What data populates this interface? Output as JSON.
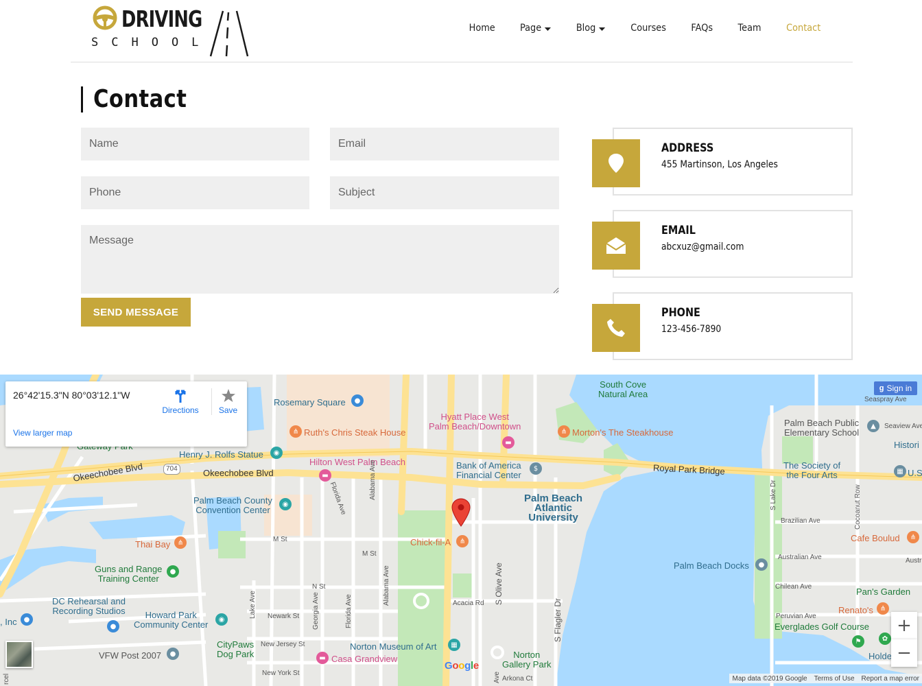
{
  "brand": {
    "top": "DRIVING",
    "bottom": "SCHOOL"
  },
  "nav": {
    "items": [
      {
        "label": "Home"
      },
      {
        "label": "Page"
      },
      {
        "label": "Blog"
      },
      {
        "label": "Courses"
      },
      {
        "label": "FAQs"
      },
      {
        "label": "Team"
      },
      {
        "label": "Contact"
      }
    ]
  },
  "contact": {
    "title": "Contact",
    "form": {
      "name_placeholder": "Name",
      "email_placeholder": "Email",
      "phone_placeholder": "Phone",
      "subject_placeholder": "Subject",
      "message_placeholder": "Message",
      "send_label": "SEND MESSAGE"
    },
    "info": [
      {
        "heading": "ADDRESS",
        "text": "455 Martinson, Los Angeles",
        "icon": "map-marker-icon"
      },
      {
        "heading": "EMAIL",
        "text": "abcxuz@gmail.com",
        "icon": "envelope-open-icon"
      },
      {
        "heading": "PHONE",
        "text": "123-456-7890",
        "icon": "phone-icon"
      }
    ]
  },
  "map": {
    "coordinates": "26°42'15.3\"N 80°03'12.1\"W",
    "directions_label": "Directions",
    "save_label": "Save",
    "larger_map_label": "View larger map",
    "sign_in_label": "Sign in",
    "zoom_in": "+",
    "zoom_out": "−",
    "logo": "Google",
    "attribution": [
      "Map data ©2019 Google",
      "Terms of Use",
      "Report a map error"
    ],
    "labels": {
      "rosemary": "Rosemary Square",
      "ruths": "Ruth's Chris Steak House",
      "hyatt": "Hyatt Place West\nPalm Beach/Downtown",
      "mortons": "Morton's The Steakhouse",
      "south_cove": "South Cove\nNatural Area",
      "seaspray": "Seaspray Ave",
      "pb_school": "Palm Beach Public\nElementary School",
      "seaview": "Seaview Ave",
      "histori": "Histori",
      "gateway": "Gateway Park",
      "rolfs": "Henry J. Rolfs Statue",
      "hilton": "Hilton West Palm Beach",
      "bofa": "Bank of America\nFinancial Center",
      "royal": "Royal Park Bridge",
      "society": "The Society of\nthe Four Arts",
      "us": "U.S",
      "okeechobee1": "Okeechobee Blvd",
      "okeechobee2": "Okeechobee Blvd",
      "route": "704",
      "convention": "Palm Beach County\nConvention Center",
      "university": "Palm Beach\nAtlantic\nUniversity",
      "flagler": "S Flagler Dr",
      "brazilian": "Brazilian Ave",
      "cafe": "Cafe Boulud",
      "thai": "Thai Bay",
      "m_st1": "M St",
      "m_st2": "M St",
      "chick": "Chick-fil-A",
      "australian": "Australian Ave",
      "austr": "Austr",
      "guns": "Guns and Range\nTraining Center",
      "docks": "Palm Beach Docks",
      "n_st": "N St",
      "chilean": "Chilean Ave",
      "pans": "Pan's Garden",
      "dc": "DC Rehearsal and\nRecording Studios",
      "acacia": "Acacia Rd",
      "renatos": "Renato's",
      "inc": ", Inc",
      "howard": "Howard Park\nCommunity Center",
      "newark": "Newark St",
      "peruvian": "Peruvian Ave",
      "everglades": "Everglades Golf Course",
      "citypaws": "CityPaws\nDog Park",
      "new_jersey": "New Jersey St",
      "norton_museum": "Norton Museum of Art",
      "norton_park": "Norton\nGallery Park",
      "vfw": "VFW Post 2007",
      "casa": "Casa Grandview",
      "new_york": "New York St",
      "arkona": "Arkona Ct",
      "holde": "Holde",
      "alabama1": "Alabama Ave",
      "alabama2": "Alabama Ave",
      "florida1": "Florida Ave",
      "florida2": "Florida Ave",
      "georgia": "Georgia Ave",
      "lake": "Lake Ave",
      "olive": "S Olive Ave",
      "lake_dr": "S Lake Dr",
      "cocoanut": "Cocoanut Row",
      "rcel": "rcel",
      "ave_bottom": "Ave"
    }
  }
}
